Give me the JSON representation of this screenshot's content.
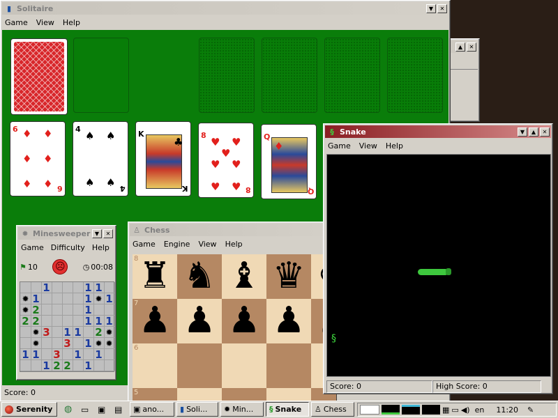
{
  "solitaire": {
    "title": "Solitaire",
    "menu": [
      "Game",
      "View",
      "Help"
    ],
    "tableau": [
      {
        "rank": "6",
        "suit": "♦",
        "color": "red"
      },
      {
        "rank": "4",
        "suit": "♠",
        "color": "black"
      },
      {
        "rank": "K",
        "suit": "♣",
        "color": "black"
      },
      {
        "rank": "8",
        "suit": "♥",
        "color": "red"
      },
      {
        "rank": "Q",
        "suit": "♦",
        "color": "red"
      }
    ]
  },
  "background_window": {
    "title": "ano..."
  },
  "minesweeper": {
    "title": "Minesweeper",
    "menu": [
      "Game",
      "Difficulty",
      "Help"
    ],
    "mines_left": "10",
    "time": "00:08",
    "face": "sad-face-icon",
    "rows": [
      "  1   11 ",
      "*1    1*1",
      "*2    1  ",
      "22    111",
      " *3 11 2*",
      " *  3 1**2",
      "11 3 1 1 ",
      "  122 1  "
    ]
  },
  "chess": {
    "title": "Chess",
    "menu": [
      "Game",
      "Engine",
      "View",
      "Help"
    ],
    "rank_labels": [
      "8",
      "7",
      "6",
      "5"
    ],
    "row8": [
      "♜",
      "♞",
      "♝",
      "♛",
      "♚"
    ],
    "row7": [
      "♟",
      "♟",
      "♟",
      "♟",
      "♟"
    ]
  },
  "snake": {
    "title": "Snake",
    "menu": [
      "Game",
      "View",
      "Help"
    ],
    "score_label": "Score: 0",
    "high_score_label": "High Score: 0"
  },
  "bottom_status": {
    "score_label": "Score: 0"
  },
  "taskbar": {
    "start_label": "Serenity",
    "buttons": [
      {
        "label": "ano..."
      },
      {
        "label": "Soli..."
      },
      {
        "label": "Min..."
      },
      {
        "label": "Snake"
      },
      {
        "label": "Chess"
      }
    ],
    "language": "en",
    "clock": "11:20"
  }
}
